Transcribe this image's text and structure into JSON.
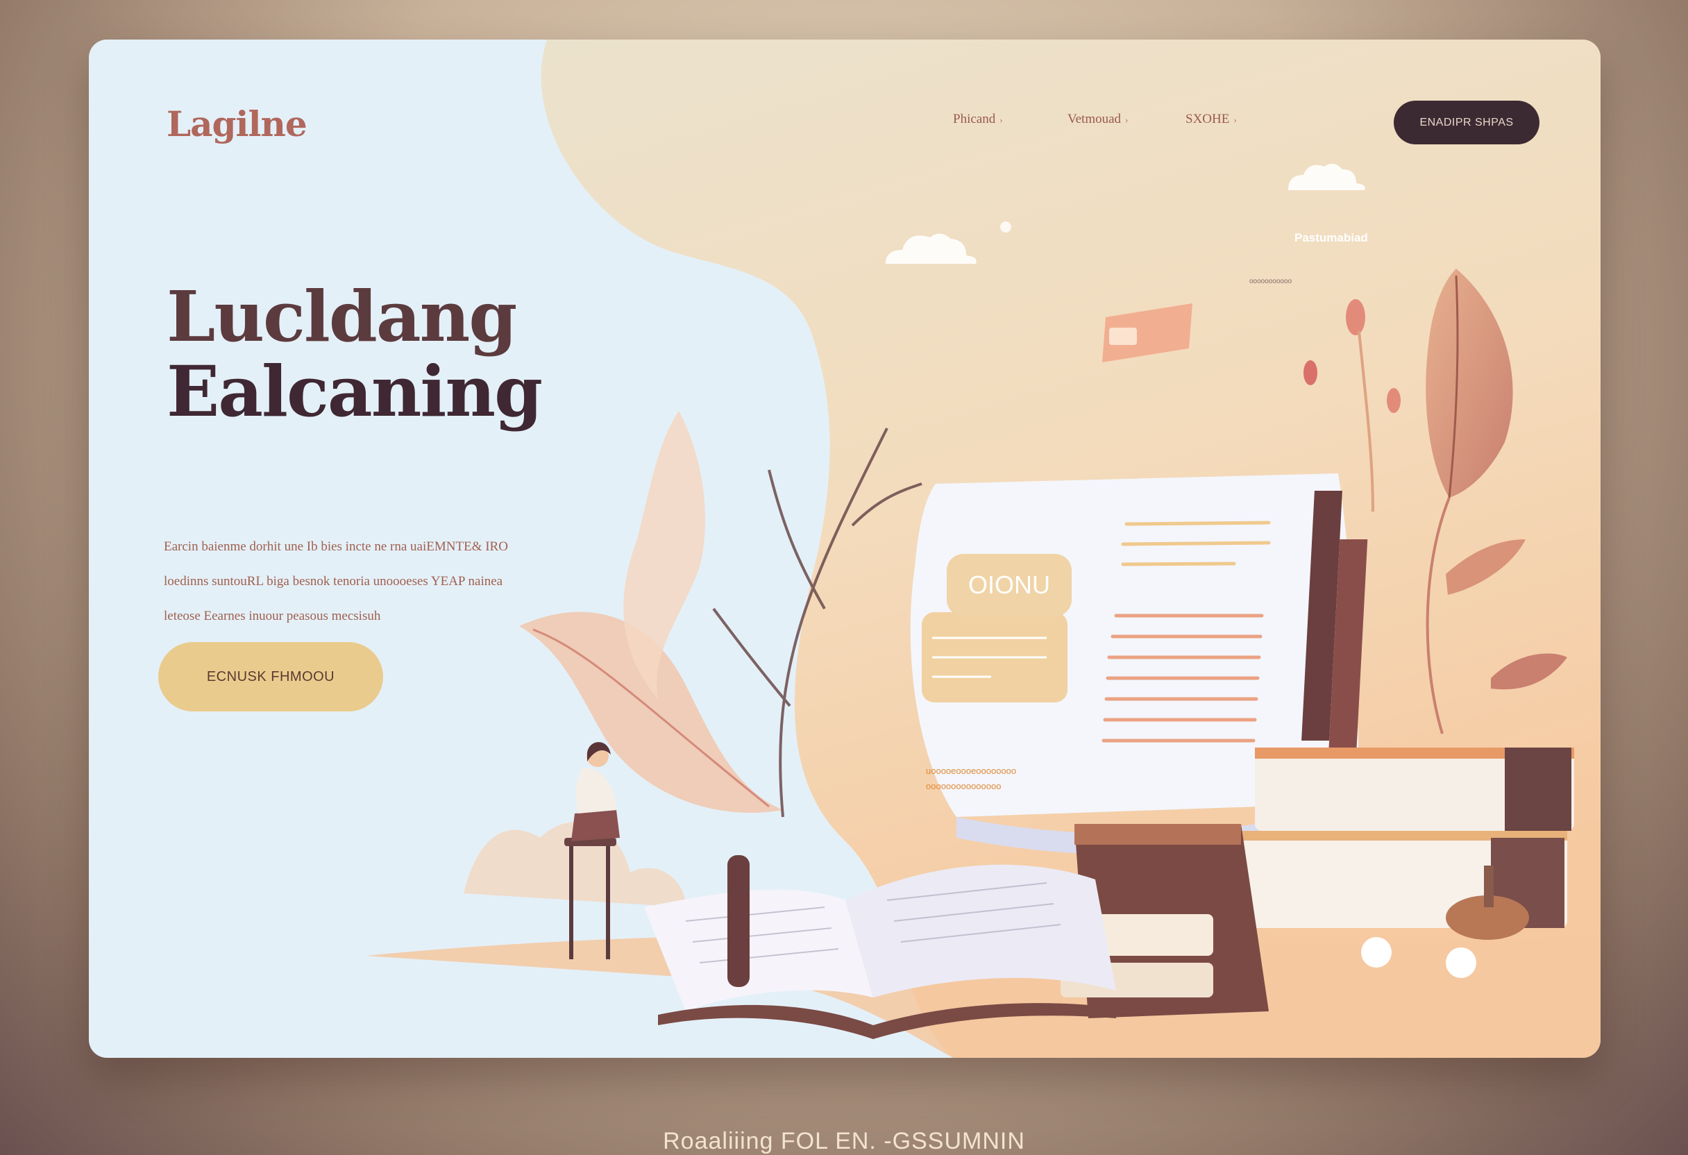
{
  "brand": {
    "logo": "Lagilne"
  },
  "nav": {
    "items": [
      {
        "label": "Phicand",
        "chevron": "chevron-down-icon"
      },
      {
        "label": "Vetmouad",
        "chevron": "chevron-down-icon"
      },
      {
        "label": "SXOHE",
        "chevron": "chevron-down-icon"
      }
    ],
    "cta_label": "ENADIPR SHPAS"
  },
  "hero": {
    "title_line1": "Lucldang",
    "title_line2": "Ealcaning",
    "description": [
      "Earcin baienme dorhit une Ib bies incte ne rna uaiEMNTE& IRO",
      "loedinns suntouRL biga besnok tenoria unoooeses YEAP nainea",
      "leteose Eearnes inuour peasous mecsisuh"
    ],
    "cta_label": "ECNUSK FHMOOU"
  },
  "illustration": {
    "doc_badge": "OIONU",
    "doc_caption_line1": "uooooeoooeoooooooo",
    "doc_caption_line2": "ooooooooooooooo",
    "floating_label": "Pastumabiad",
    "floating_sub": "ooooooooooo"
  },
  "footer_caption": "Roaaliiing FOL EN. -GSSUMNIN",
  "colors": {
    "accent_dark": "#3c2a33",
    "accent_gold": "#eacb8e",
    "brand": "#b0675c",
    "panel_blue": "#e4f0f8",
    "panel_peach": "#f3d6b1"
  }
}
